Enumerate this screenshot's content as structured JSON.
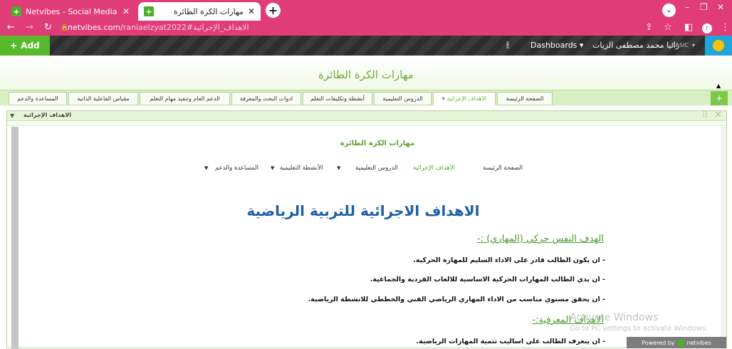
{
  "browser": {
    "tabs": [
      {
        "title": "Netvibes - Social Media Monitor",
        "active": false
      },
      {
        "title": "مهارات الكرة الطائرة",
        "active": true
      }
    ],
    "url_host": "netvibes.com",
    "url_path": "/raniaelzyat2022#الاهداف_الإجرائية",
    "profile_letter": "r"
  },
  "netvibes_bar": {
    "add_label": "Add",
    "dashboards_label": "Dashboards",
    "user_name": "رانيا محمد مصطفى الزيات",
    "plan_label": "BASIC"
  },
  "dashboard": {
    "title": "مهارات الكرة الطائرة",
    "tabs": [
      "الصفحة الرئيسة",
      "الاهداف الإجرائية",
      "الدروس التعليمية",
      "أنشطة وتكليفات التعلم",
      "ادوات البحث والمعرفة",
      "الدعم العام وتنفيذ مهام التعلم",
      "مقياس الفاعلية الذاتية",
      "المساعدة والدعم"
    ]
  },
  "widget": {
    "title": "الاهداف الإجرائية"
  },
  "page": {
    "site_title": "مهارات الكرة الطائرة",
    "menu": [
      "الصفحة الرئيسة",
      "الأهداف الإجرائية",
      "الدروس التعليمية",
      "الأنشطة التعليمية",
      "المساعدة والدعم"
    ],
    "heading": "الاهداف الاجرائية للتربية الرياضية",
    "section1": "الهدف النفس حركي (المهاري) :-",
    "bullets1": [
      "- ان يكون الطالب قادر علي الاداء السليم للمهارة الحركية.",
      "- ان يدي الطالب المهارات الحركية الاساسية للالعاب الفردية والجماعية.",
      "- ان يحقق مستوي مناسب من الاداء المهاري الرياضي الفني والخططي للانشطة الرياضية."
    ],
    "section2": "الاهداف المعرفية:-",
    "bullets2": [
      "- ان يتعرف الطالب علي اساليب تنمية المهارات الرياضية."
    ]
  },
  "overlay": {
    "activate_title": "Activate Windows",
    "activate_sub": "Go to PC settings to activate Windows.",
    "powered_by": "Powered by",
    "powered_brand": "netvibes"
  },
  "colors": {
    "browser_chrome": "#e03c78",
    "netvibes_green": "#58b92b",
    "heading_blue": "#1f5fa5"
  }
}
